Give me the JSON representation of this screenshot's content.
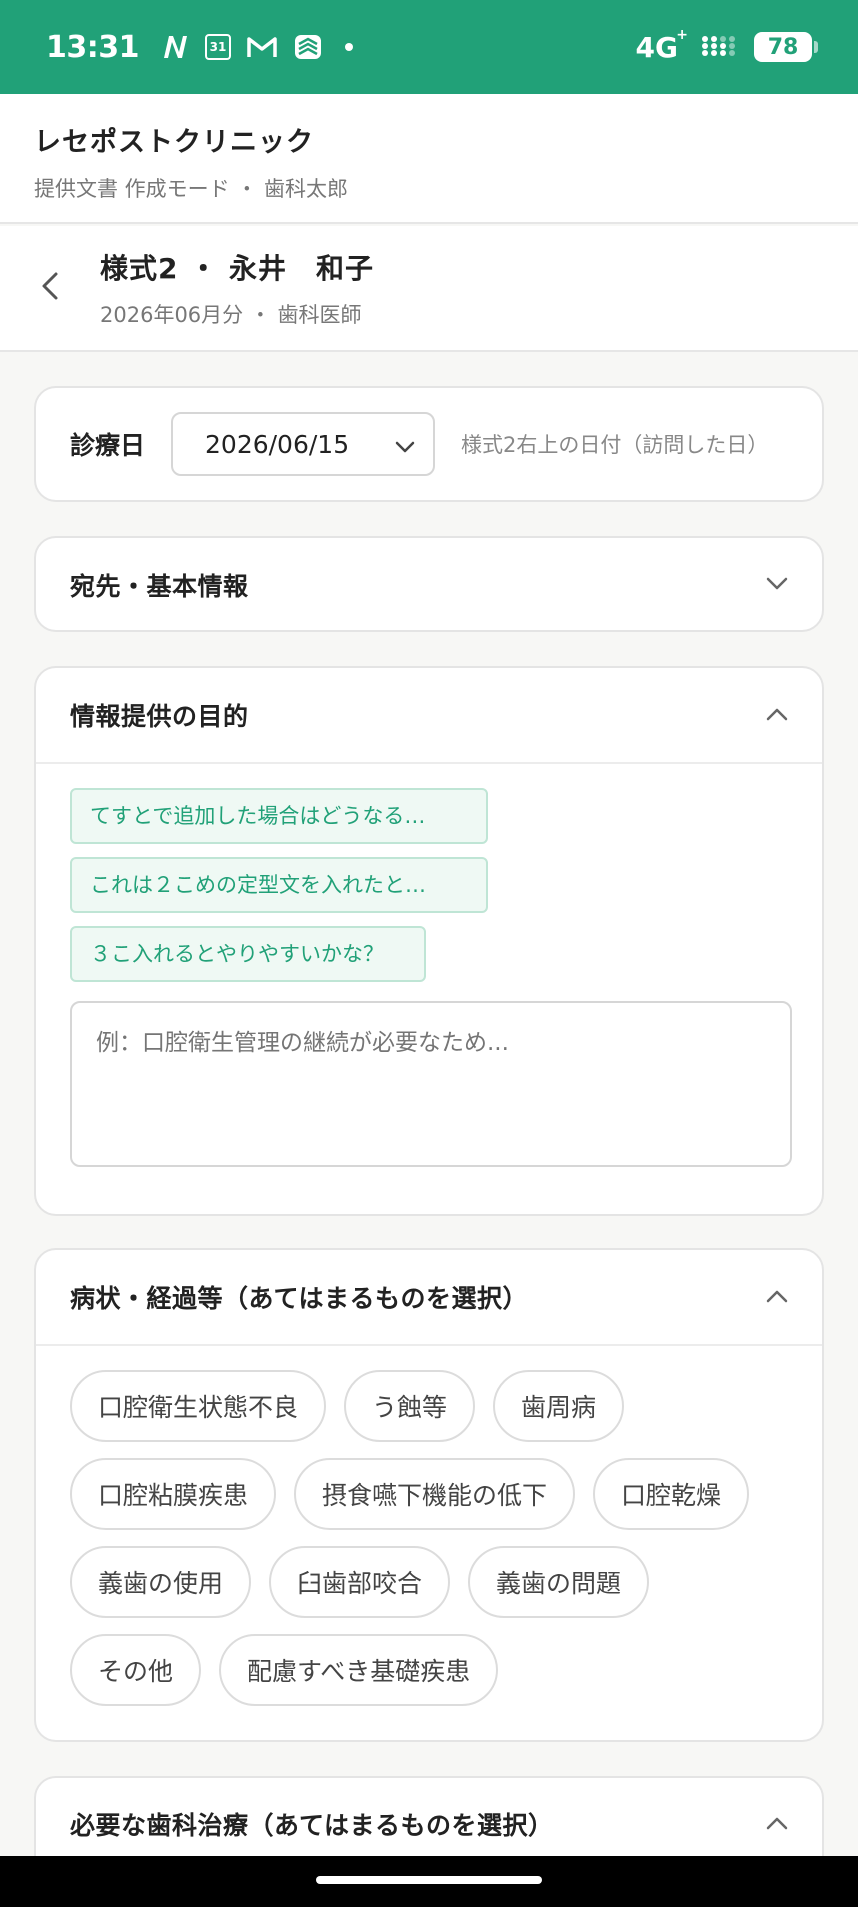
{
  "status": {
    "time": "13:31",
    "network": "4G",
    "network_sup": "+",
    "calendar_day": "31",
    "battery": "78"
  },
  "app": {
    "title": "レセポストクリニック",
    "subtitle": "提供文書 作成モード ・ 歯科太郎"
  },
  "document": {
    "title": "様式2 ・ 永井　和子",
    "subtitle": "2026年06月分 ・ 歯科医師"
  },
  "date_section": {
    "label": "診療日",
    "value": "2026/06/15",
    "hint": "様式2右上の日付（訪問した日）"
  },
  "basic_info": {
    "title": "宛先・基本情報"
  },
  "purpose": {
    "title": "情報提供の目的",
    "templates": [
      "てすとで追加した場合はどうなる…",
      "これは２こめの定型文を入れたと…",
      "３こ入れるとやりやすいかな？"
    ],
    "placeholder": "例：口腔衛生管理の継続が必要なため..."
  },
  "condition": {
    "title": "病状・経過等（あてはまるものを選択）",
    "options": [
      "口腔衛生状態不良",
      "う蝕等",
      "歯周病",
      "口腔粘膜疾患",
      "摂食嚥下機能の低下",
      "口腔乾燥",
      "義歯の使用",
      "臼歯部咬合",
      "義歯の問題",
      "その他",
      "配慮すべき基礎疾患"
    ]
  },
  "treatment": {
    "title": "必要な歯科治療（あてはまるものを選択）"
  },
  "colors": {
    "accent": "#21a178",
    "chip_bg": "#eff9f4",
    "chip_border": "#bfe5d5"
  }
}
